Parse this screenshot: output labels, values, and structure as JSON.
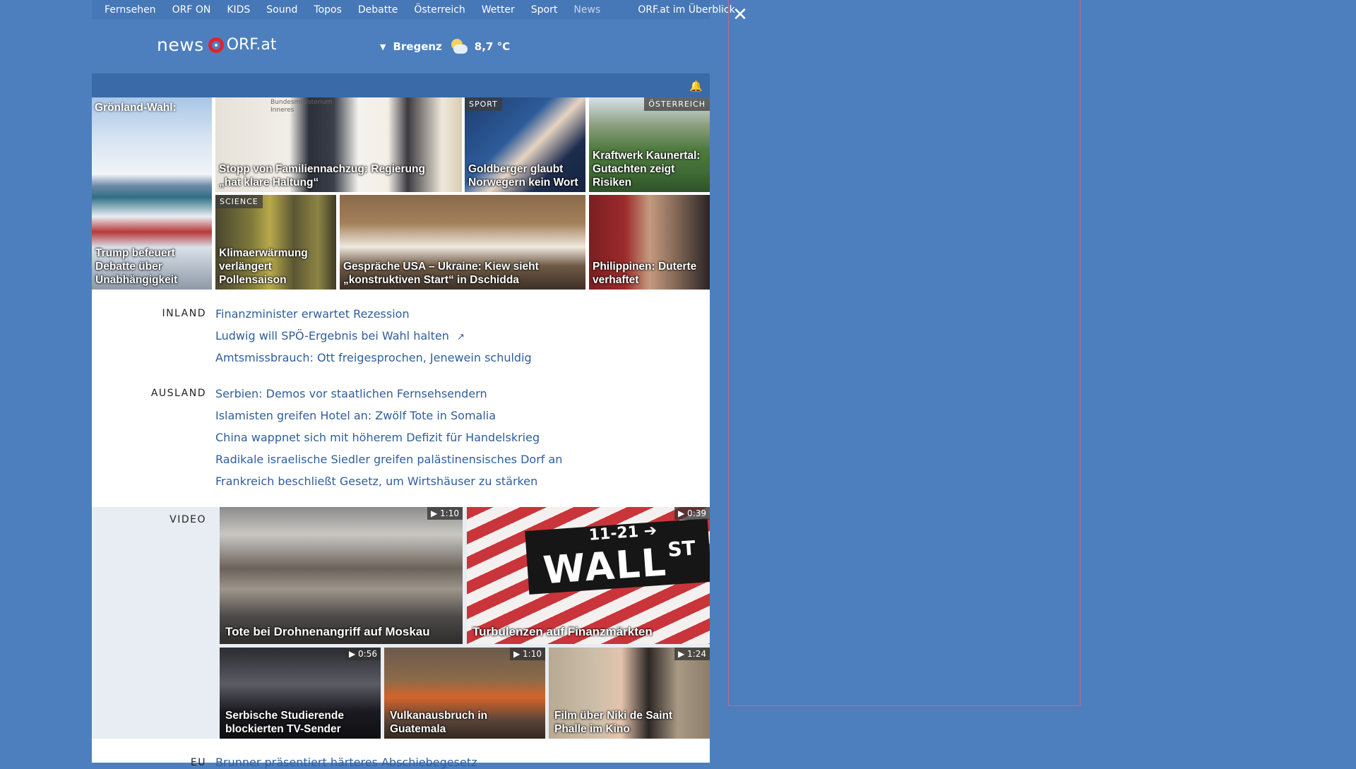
{
  "topnav": {
    "items": [
      "Fernsehen",
      "ORF ON",
      "KIDS",
      "Sound",
      "Topos",
      "Debatte",
      "Österreich",
      "Wetter",
      "Sport",
      "News"
    ],
    "overview": "ORF.at im Überblick"
  },
  "header": {
    "logo_news": "news",
    "logo_orf": "ORF.at",
    "weather_city": "Bregenz",
    "weather_temp": "8,7 °C"
  },
  "top_stories": [
    {
      "toplabel": "Grönland-Wahl:",
      "caption": "Trump befeuert Debatte über Unabhängigkeit"
    },
    {
      "caption": "Stopp von Familiennachzug: Regierung „hat klare Haltung“",
      "image_text": "Bundesministerium Inneres"
    },
    {
      "tag": "SPORT",
      "caption": "Goldberger glaubt Norwegern kein Wort"
    },
    {
      "tag": "ÖSTERREICH",
      "caption": "Kraftwerk Kaunertal: Gutachten zeigt Risiken"
    },
    {
      "tag": "SCIENCE",
      "caption": "Klimaerwärmung verlängert Pollensaison"
    },
    {
      "caption": "Gespräche USA – Ukraine: Kiew sieht „konstruktiven Start“ in Dschidda"
    },
    {
      "caption": "Philippinen: Duterte verhaftet"
    }
  ],
  "inland": {
    "label": "INLAND",
    "links": [
      "Finanzminister erwartet Rezession",
      "Ludwig will SPÖ-Ergebnis bei Wahl halten",
      "Amtsmissbrauch: Ott freigesprochen, Jenewein schuldig"
    ]
  },
  "ausland": {
    "label": "AUSLAND",
    "links": [
      "Serbien: Demos vor staatlichen Fernsehsendern",
      "Islamisten greifen Hotel an: Zwölf Tote in Somalia",
      "China wappnet sich mit höherem Defizit für Handelskrieg",
      "Radikale israelische Siedler greifen palästinensisches Dorf an",
      "Frankreich beschließt Gesetz, um Wirtshäuser zu stärken"
    ]
  },
  "video": {
    "label": "VIDEO",
    "items": [
      {
        "duration": "1:10",
        "caption": "Tote bei Drohnenangriff auf Moskau"
      },
      {
        "duration": "0:39",
        "caption": "Turbulenzen auf Finanzmärkten",
        "sign_date": "11-21",
        "sign_street": "WALL",
        "sign_suffix": "ST"
      },
      {
        "duration": "0:56",
        "caption": "Serbische Studierende blockierten TV-Sender"
      },
      {
        "duration": "1:10",
        "caption": "Vulkanausbruch in Guatemala"
      },
      {
        "duration": "1:24",
        "caption": "Film über Niki de Saint Phalle im Kino"
      }
    ]
  },
  "eu": {
    "label": "EU",
    "links": [
      "Brunner präsentiert härteres Abschiebegesetz"
    ]
  }
}
